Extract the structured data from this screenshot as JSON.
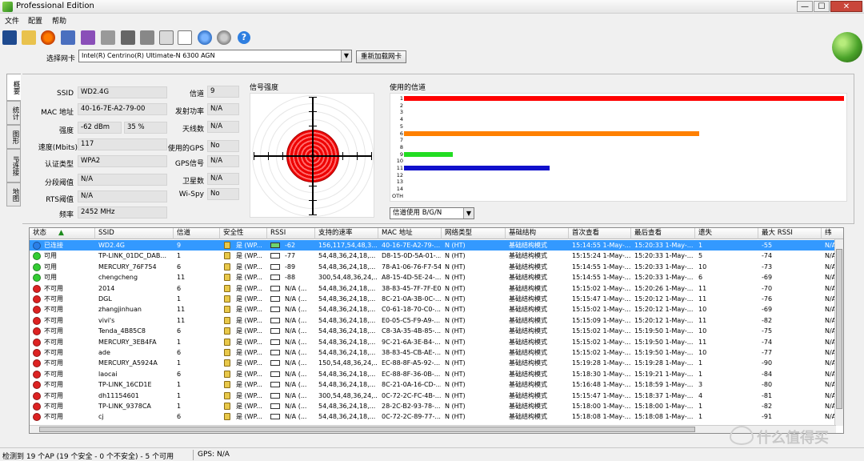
{
  "window": {
    "title": "Professional Edition",
    "min": "—",
    "max": "☐",
    "close": "✕"
  },
  "menu": [
    "文件",
    "配置",
    "帮助"
  ],
  "toolbar": {
    "help": "?"
  },
  "adapter": {
    "label": "选择网卡",
    "selected": "Intel(R) Centrino(R) Ultimate-N 6300 AGN",
    "reload_button": "重新加载网卡"
  },
  "side_tabs": [
    "概要",
    "统计",
    "图形",
    "IP连接",
    "地图"
  ],
  "info": {
    "ssid_label": "SSID",
    "ssid": "WD2.4G",
    "mac_label": "MAC 地址",
    "mac": "40-16-7E-A2-79-00",
    "strength_label": "强度",
    "strength_dbm": "-62 dBm",
    "strength_pct": "35 %",
    "rate_label": "速度(Mbits)",
    "rate": "117",
    "auth_label": "认证类型",
    "auth": "WPA2",
    "frag_label": "分段阈值",
    "frag": "N/A",
    "rts_label": "RTS阈值",
    "rts": "N/A",
    "freq_label": "频率",
    "freq": "2452 MHz",
    "channel_label": "信道",
    "channel": "9",
    "txpower_label": "发射功率",
    "txpower": "N/A",
    "antenna_label": "天线数",
    "antenna": "N/A",
    "gps_used_label": "使用的GPS",
    "gps_used": "No",
    "gps_signal_label": "GPS信号",
    "gps_signal": "N/A",
    "satellites_label": "卫星数",
    "satellites": "N/A",
    "wispy_label": "Wi-Spy",
    "wispy": "No"
  },
  "signal": {
    "title": "信号强度"
  },
  "channels": {
    "title": "使用的信道",
    "labels": [
      "1",
      "2",
      "3",
      "4",
      "5",
      "6",
      "7",
      "8",
      "9",
      "10",
      "11",
      "12",
      "13",
      "14",
      "OTH"
    ],
    "used": [
      {
        "channel": "1",
        "usage": 1.0,
        "color": "#ff0000"
      },
      {
        "channel": "6",
        "usage": 0.67,
        "color": "#ff8000"
      },
      {
        "channel": "9",
        "usage": 0.11,
        "color": "#22dd22"
      },
      {
        "channel": "11",
        "usage": 0.33,
        "color": "#1010cc"
      }
    ],
    "mode": "信道使用 B/G/N"
  },
  "table": {
    "sort_indicator": "▲",
    "columns": [
      "状态",
      "SSID",
      "信道",
      "安全性",
      "RSSI",
      "支持的速率",
      "MAC 地址",
      "网络类型",
      "基础结构",
      "首次查看",
      "最后查看",
      "遗失",
      "最大 RSSI",
      "纬"
    ],
    "rows": [
      {
        "status": "已连接",
        "status_color": "#2a7fe8",
        "ssid": "WD2.4G",
        "channel": "9",
        "security": "是 (WP...",
        "rssi": "-62",
        "rates": "156,117,54,48,3...",
        "mac": "40-16-7E-A2-79-...",
        "nettype": "N (HT)",
        "infra": "基础结构模式",
        "first": "15:14:55 1-May-...",
        "last": "15:20:33 1-May-...",
        "lost": "1",
        "maxrssi": "-55",
        "lat": "N/A"
      },
      {
        "status": "可用",
        "status_color": "#33cc33",
        "ssid": "TP-LINK_01DC_DAB...",
        "channel": "1",
        "security": "是 (WP...",
        "rssi": "-77",
        "rates": "54,48,36,24,18,...",
        "mac": "D8-15-0D-5A-01-...",
        "nettype": "N (HT)",
        "infra": "基础结构模式",
        "first": "15:15:24 1-May-...",
        "last": "15:20:33 1-May-...",
        "lost": "5",
        "maxrssi": "-74",
        "lat": "N/A"
      },
      {
        "status": "可用",
        "status_color": "#33cc33",
        "ssid": "MERCURY_76F754",
        "channel": "6",
        "security": "是 (WP...",
        "rssi": "-89",
        "rates": "54,48,36,24,18,...",
        "mac": "78-A1-06-76-F7-54",
        "nettype": "N (HT)",
        "infra": "基础结构模式",
        "first": "15:14:55 1-May-...",
        "last": "15:20:33 1-May-...",
        "lost": "10",
        "maxrssi": "-73",
        "lat": "N/A"
      },
      {
        "status": "可用",
        "status_color": "#33cc33",
        "ssid": "chengcheng",
        "channel": "11",
        "security": "是 (WP...",
        "rssi": "-88",
        "rates": "300,54,48,36,24,...",
        "mac": "A8-15-4D-5E-24-...",
        "nettype": "N (HT)",
        "infra": "基础结构模式",
        "first": "15:14:55 1-May-...",
        "last": "15:20:33 1-May-...",
        "lost": "6",
        "maxrssi": "-69",
        "lat": "N/A"
      },
      {
        "status": "不可用",
        "status_color": "#dd2222",
        "ssid": "2014",
        "channel": "6",
        "security": "是 (WP...",
        "rssi": "N/A (...",
        "rates": "54,48,36,24,18,...",
        "mac": "38-83-45-7F-7F-E0",
        "nettype": "N (HT)",
        "infra": "基础结构模式",
        "first": "15:15:02 1-May-...",
        "last": "15:20:26 1-May-...",
        "lost": "11",
        "maxrssi": "-70",
        "lat": "N/A"
      },
      {
        "status": "不可用",
        "status_color": "#dd2222",
        "ssid": "DGL",
        "channel": "1",
        "security": "是 (WP...",
        "rssi": "N/A (...",
        "rates": "54,48,36,24,18,...",
        "mac": "8C-21-0A-3B-0C-...",
        "nettype": "N (HT)",
        "infra": "基础结构模式",
        "first": "15:15:47 1-May-...",
        "last": "15:20:12 1-May-...",
        "lost": "11",
        "maxrssi": "-76",
        "lat": "N/A"
      },
      {
        "status": "不可用",
        "status_color": "#dd2222",
        "ssid": "zhangjinhuan",
        "channel": "11",
        "security": "是 (WP...",
        "rssi": "N/A (...",
        "rates": "54,48,36,24,18,...",
        "mac": "C0-61-18-70-C0-...",
        "nettype": "N (HT)",
        "infra": "基础结构模式",
        "first": "15:15:02 1-May-...",
        "last": "15:20:12 1-May-...",
        "lost": "10",
        "maxrssi": "-69",
        "lat": "N/A"
      },
      {
        "status": "不可用",
        "status_color": "#dd2222",
        "ssid": "vivi's",
        "channel": "11",
        "security": "是 (WP...",
        "rssi": "N/A (...",
        "rates": "54,48,36,24,18,...",
        "mac": "E0-05-C5-F9-A9-...",
        "nettype": "N (HT)",
        "infra": "基础结构模式",
        "first": "15:15:09 1-May-...",
        "last": "15:20:12 1-May-...",
        "lost": "11",
        "maxrssi": "-82",
        "lat": "N/A"
      },
      {
        "status": "不可用",
        "status_color": "#dd2222",
        "ssid": "Tenda_4B85C8",
        "channel": "6",
        "security": "是 (WP...",
        "rssi": "N/A (...",
        "rates": "54,48,36,24,18,...",
        "mac": "C8-3A-35-4B-85-...",
        "nettype": "N (HT)",
        "infra": "基础结构模式",
        "first": "15:15:02 1-May-...",
        "last": "15:19:50 1-May-...",
        "lost": "10",
        "maxrssi": "-75",
        "lat": "N/A"
      },
      {
        "status": "不可用",
        "status_color": "#dd2222",
        "ssid": "MERCURY_3EB4FA",
        "channel": "1",
        "security": "是 (WP...",
        "rssi": "N/A (...",
        "rates": "54,48,36,24,18,...",
        "mac": "9C-21-6A-3E-B4-...",
        "nettype": "N (HT)",
        "infra": "基础结构模式",
        "first": "15:15:02 1-May-...",
        "last": "15:19:50 1-May-...",
        "lost": "11",
        "maxrssi": "-74",
        "lat": "N/A"
      },
      {
        "status": "不可用",
        "status_color": "#dd2222",
        "ssid": "ade",
        "channel": "6",
        "security": "是 (WP...",
        "rssi": "N/A (...",
        "rates": "54,48,36,24,18,...",
        "mac": "38-83-45-CB-AE-...",
        "nettype": "N (HT)",
        "infra": "基础结构模式",
        "first": "15:15:02 1-May-...",
        "last": "15:19:50 1-May-...",
        "lost": "10",
        "maxrssi": "-77",
        "lat": "N/A"
      },
      {
        "status": "不可用",
        "status_color": "#dd2222",
        "ssid": "MERCURY_A5924A",
        "channel": "1",
        "security": "是 (WP...",
        "rssi": "N/A (...",
        "rates": "150,54,48,36,24,...",
        "mac": "EC-88-8F-A5-92-...",
        "nettype": "N (HT)",
        "infra": "基础结构模式",
        "first": "15:19:28 1-May-...",
        "last": "15:19:28 1-May-...",
        "lost": "1",
        "maxrssi": "-90",
        "lat": "N/A"
      },
      {
        "status": "不可用",
        "status_color": "#dd2222",
        "ssid": "laocai",
        "channel": "6",
        "security": "是 (WP...",
        "rssi": "N/A (...",
        "rates": "54,48,36,24,18,...",
        "mac": "EC-88-8F-36-0B-...",
        "nettype": "N (HT)",
        "infra": "基础结构模式",
        "first": "15:18:30 1-May-...",
        "last": "15:19:21 1-May-...",
        "lost": "1",
        "maxrssi": "-84",
        "lat": "N/A"
      },
      {
        "status": "不可用",
        "status_color": "#dd2222",
        "ssid": "TP-LINK_16CD1E",
        "channel": "1",
        "security": "是 (WP...",
        "rssi": "N/A (...",
        "rates": "54,48,36,24,18,...",
        "mac": "8C-21-0A-16-CD-...",
        "nettype": "N (HT)",
        "infra": "基础结构模式",
        "first": "15:16:48 1-May-...",
        "last": "15:18:59 1-May-...",
        "lost": "3",
        "maxrssi": "-80",
        "lat": "N/A"
      },
      {
        "status": "不可用",
        "status_color": "#dd2222",
        "ssid": "dh11154601",
        "channel": "1",
        "security": "是 (WP...",
        "rssi": "N/A (...",
        "rates": "300,54,48,36,24,...",
        "mac": "0C-72-2C-FC-4B-...",
        "nettype": "N (HT)",
        "infra": "基础结构模式",
        "first": "15:15:47 1-May-...",
        "last": "15:18:37 1-May-...",
        "lost": "4",
        "maxrssi": "-81",
        "lat": "N/A"
      },
      {
        "status": "不可用",
        "status_color": "#dd2222",
        "ssid": "TP-LINK_9378CA",
        "channel": "1",
        "security": "是 (WP...",
        "rssi": "N/A (...",
        "rates": "54,48,36,24,18,...",
        "mac": "28-2C-B2-93-78-...",
        "nettype": "N (HT)",
        "infra": "基础结构模式",
        "first": "15:18:00 1-May-...",
        "last": "15:18:00 1-May-...",
        "lost": "1",
        "maxrssi": "-82",
        "lat": "N/A"
      },
      {
        "status": "不可用",
        "status_color": "#dd2222",
        "ssid": "cj",
        "channel": "6",
        "security": "是 (WP...",
        "rssi": "N/A (...",
        "rates": "54,48,36,24,18,...",
        "mac": "0C-72-2C-89-77-...",
        "nettype": "N (HT)",
        "infra": "基础结构模式",
        "first": "15:18:08 1-May-...",
        "last": "15:18:08 1-May-...",
        "lost": "1",
        "maxrssi": "-91",
        "lat": "N/A"
      }
    ]
  },
  "statusbar": {
    "summary": "检测到 19 个AP (19 个安全 - 0 个不安全) - 5 个可用",
    "gps": "GPS: N/A"
  },
  "watermark": "什么值得买"
}
